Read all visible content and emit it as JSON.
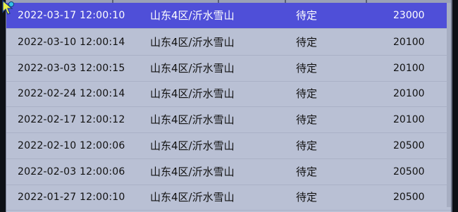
{
  "rows": [
    {
      "time": "2022-03-17 12:00:10",
      "server": "山东4区/沂水雪山",
      "status": "待定",
      "price": "23000"
    },
    {
      "time": "2022-03-10 12:00:14",
      "server": "山东4区/沂水雪山",
      "status": "待定",
      "price": "20100"
    },
    {
      "time": "2022-03-03 12:00:15",
      "server": "山东4区/沂水雪山",
      "status": "待定",
      "price": "20100"
    },
    {
      "time": "2022-02-24 12:00:14",
      "server": "山东4区/沂水雪山",
      "status": "待定",
      "price": "20100"
    },
    {
      "time": "2022-02-17 12:00:12",
      "server": "山东4区/沂水雪山",
      "status": "待定",
      "price": "20100"
    },
    {
      "time": "2022-02-10 12:00:06",
      "server": "山东4区/沂水雪山",
      "status": "待定",
      "price": "20500"
    },
    {
      "time": "2022-02-03 12:00:06",
      "server": "山东4区/沂水雪山",
      "status": "待定",
      "price": "20500"
    },
    {
      "time": "2022-01-27 12:00:10",
      "server": "山东4区/沂水雪山",
      "status": "待定",
      "price": "20500"
    }
  ],
  "selected_row_index": 0,
  "colors": {
    "selected_row": "#4f4fd8",
    "panel": "#b9c0d4",
    "border": "#0d1016"
  },
  "icons": {
    "cursor": "mouse-pointer-icon"
  }
}
